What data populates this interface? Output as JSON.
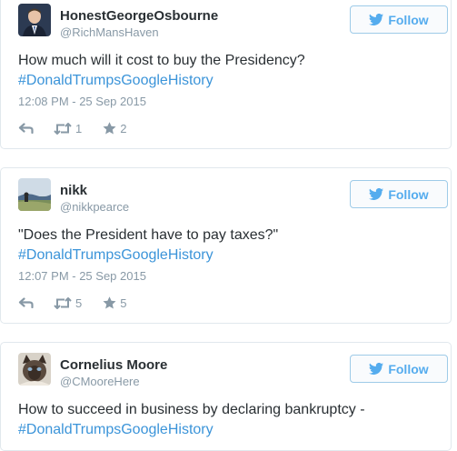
{
  "follow_label": "Follow",
  "tweets": [
    {
      "name": "HonestGeorgeOsbourne",
      "handle": "@RichMansHaven",
      "text": "How much will it cost to buy the Presidency?",
      "hashtag": "#DonaldTrumpsGoogleHistory",
      "time": "12:08 PM - 25 Sep 2015",
      "retweets": "1",
      "favorites": "2"
    },
    {
      "name": "nikk",
      "handle": "@nikkpearce",
      "text": "\"Does the President have to pay taxes?\"",
      "hashtag": "#DonaldTrumpsGoogleHistory",
      "time": "12:07 PM - 25 Sep 2015",
      "retweets": "5",
      "favorites": "5"
    },
    {
      "name": "Cornelius Moore",
      "handle": "@CMooreHere",
      "text": "How to succeed in business by declaring bankruptcy -",
      "hashtag": "#DonaldTrumpsGoogleHistory"
    }
  ],
  "colors": {
    "link": "#3b94d9",
    "follow_accent": "#55acee",
    "meta_gray": "#8899a6",
    "text": "#292f33"
  }
}
